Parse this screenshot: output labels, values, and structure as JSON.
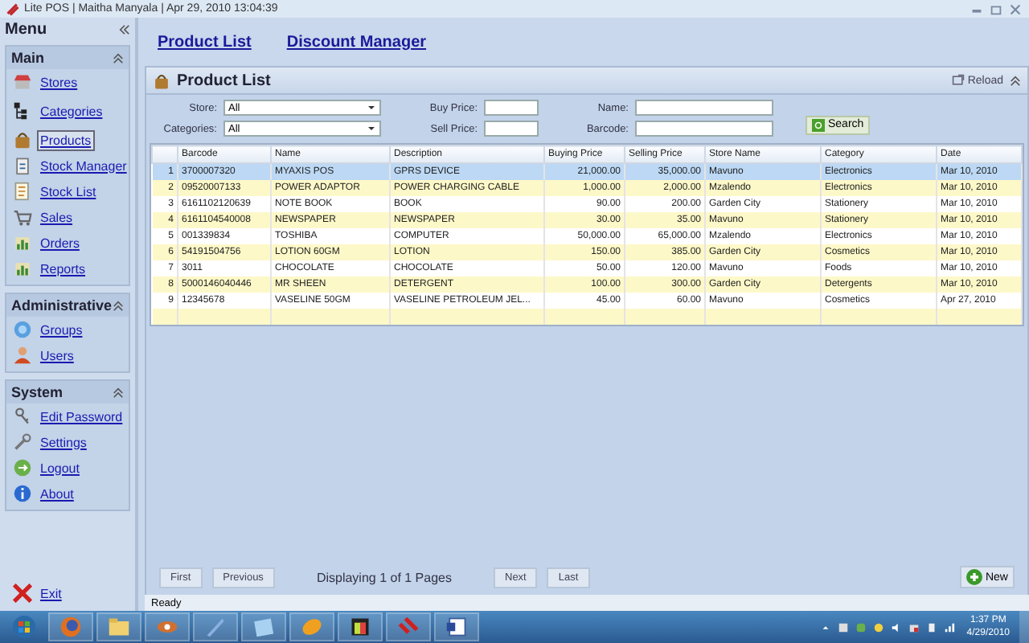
{
  "window": {
    "title": "Lite POS  | Maitha Manyala | Apr 29, 2010 13:04:39"
  },
  "sidebar": {
    "title": "Menu",
    "sections": [
      {
        "title": "Main",
        "items": [
          {
            "label": "Stores",
            "kind": "stores",
            "selected": false
          },
          {
            "label": "Categories",
            "kind": "categories",
            "selected": false
          },
          {
            "label": "Products",
            "kind": "products",
            "selected": true
          },
          {
            "label": "Stock Manager",
            "kind": "stock",
            "selected": false
          },
          {
            "label": "Stock List",
            "kind": "list",
            "selected": false
          },
          {
            "label": "Sales",
            "kind": "sales",
            "selected": false
          },
          {
            "label": "Orders",
            "kind": "orders",
            "selected": false
          },
          {
            "label": "Reports",
            "kind": "reports",
            "selected": false
          }
        ]
      },
      {
        "title": "Administrative",
        "items": [
          {
            "label": "Groups",
            "kind": "groups",
            "selected": false
          },
          {
            "label": "Users",
            "kind": "users",
            "selected": false
          }
        ]
      },
      {
        "title": "System",
        "items": [
          {
            "label": "Edit Password",
            "kind": "password",
            "selected": false
          },
          {
            "label": "Settings",
            "kind": "settings",
            "selected": false
          },
          {
            "label": "Logout",
            "kind": "logout",
            "selected": false
          },
          {
            "label": "About",
            "kind": "about",
            "selected": false
          }
        ]
      }
    ],
    "exit": "Exit"
  },
  "tabs": [
    {
      "label": "Product List"
    },
    {
      "label": "Discount Manager"
    }
  ],
  "panel": {
    "title": "Product List",
    "reload": "Reload"
  },
  "filters": [
    {
      "label": "Store:",
      "value": "All",
      "kind": "select"
    },
    {
      "label": "Buy Price:",
      "kind": "text"
    },
    {
      "label": "Name:",
      "kind": "wide"
    },
    {
      "label": "Categories:",
      "value": "All",
      "kind": "select"
    },
    {
      "label": "Sell Price:",
      "kind": "text"
    },
    {
      "label": "Barcode:",
      "kind": "wide"
    }
  ],
  "search_button": "Search",
  "table": {
    "columns": [
      "Barcode",
      "Name",
      "Description",
      "Buying Price",
      "Selling Price",
      "Store Name",
      "Category",
      "Date"
    ],
    "rows": [
      {
        "number": "1",
        "selected": true,
        "cells": [
          "3700007320",
          "MYAXIS POS",
          "GPRS DEVICE",
          "21,000.00",
          "35,000.00",
          "Mavuno",
          "Electronics",
          "Mar 10, 2010"
        ]
      },
      {
        "number": "2",
        "selected": false,
        "cells": [
          "09520007133",
          "POWER ADAPTOR",
          "POWER CHARGING CABLE",
          "1,000.00",
          "2,000.00",
          "Mzalendo",
          "Electronics",
          "Mar 10, 2010"
        ]
      },
      {
        "number": "3",
        "selected": false,
        "cells": [
          "6161102120639",
          "NOTE BOOK",
          "BOOK",
          "90.00",
          "200.00",
          "Garden City",
          "Stationery",
          "Mar 10, 2010"
        ]
      },
      {
        "number": "4",
        "selected": false,
        "cells": [
          "6161104540008",
          "NEWSPAPER",
          "NEWSPAPER",
          "30.00",
          "35.00",
          "Mavuno",
          "Stationery",
          "Mar 10, 2010"
        ]
      },
      {
        "number": "5",
        "selected": false,
        "cells": [
          "001339834",
          "TOSHIBA",
          "COMPUTER",
          "50,000.00",
          "65,000.00",
          "Mzalendo",
          "Electronics",
          "Mar 10, 2010"
        ]
      },
      {
        "number": "6",
        "selected": false,
        "cells": [
          "54191504756",
          "LOTION 60GM",
          "LOTION",
          "150.00",
          "385.00",
          "Garden City",
          "Cosmetics",
          "Mar 10, 2010"
        ]
      },
      {
        "number": "7",
        "selected": false,
        "cells": [
          "3011",
          "CHOCOLATE",
          "CHOCOLATE",
          "50.00",
          "120.00",
          "Mavuno",
          "Foods",
          "Mar 10, 2010"
        ]
      },
      {
        "number": "8",
        "selected": false,
        "cells": [
          "5000146040446",
          "MR SHEEN",
          "DETERGENT",
          "100.00",
          "300.00",
          "Garden City",
          "Detergents",
          "Mar 10, 2010"
        ]
      },
      {
        "number": "9",
        "selected": false,
        "cells": [
          "12345678",
          "VASELINE 50GM",
          "VASELINE PETROLEUM JEL...",
          "45.00",
          "60.00",
          "Mavuno",
          "Cosmetics",
          "Apr 27, 2010"
        ]
      }
    ]
  },
  "pager": {
    "first": "First",
    "previous": "Previous",
    "info": "Displaying 1 of 1 Pages",
    "next": "Next",
    "last": "Last"
  },
  "new_button": "New",
  "status_bar": "Ready",
  "taskbar": {
    "items": [
      {
        "kind": "start"
      },
      {
        "kind": "browser"
      },
      {
        "kind": "folder"
      },
      {
        "kind": "media"
      },
      {
        "kind": "pen"
      },
      {
        "kind": "window"
      },
      {
        "kind": "disc"
      },
      {
        "kind": "palette"
      },
      {
        "kind": "app"
      },
      {
        "kind": "document"
      }
    ],
    "time": "1:37 PM",
    "date": "4/29/2010"
  }
}
